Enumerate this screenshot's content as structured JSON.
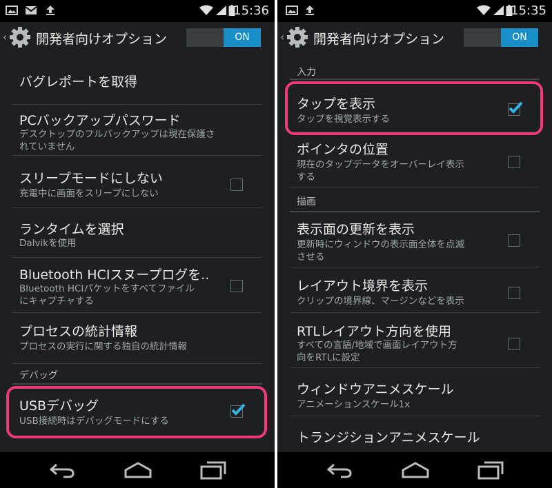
{
  "left": {
    "status": {
      "time": "15:36"
    },
    "header": {
      "title": "開発者向けオプション",
      "switch": "ON"
    },
    "items": [
      {
        "title": "バグレポートを取得"
      },
      {
        "title": "PCバックアップパスワード",
        "sub1": "デスクトップのフルバックアップは現在保護さ",
        "sub2": "れていません"
      },
      {
        "title": "スリープモードにしない",
        "sub1": "充電中に画面をスリープにしない"
      },
      {
        "title": "ランタイムを選択",
        "sub1": "Dalvikを使用"
      },
      {
        "title": "Bluetooth HCIスヌープログを..",
        "sub1": "Bluetooth HCIパケットをすべてファイル",
        "sub2": "にキャプチャする"
      },
      {
        "title": "プロセスの統計情報",
        "sub1": "プロセスの実行に関する独自の統計情報"
      }
    ],
    "category": "デバッグ",
    "usb": {
      "title": "USBデバッグ",
      "sub1": "USB接続時はデバッグモードにする"
    }
  },
  "right": {
    "status": {
      "time": "15:35"
    },
    "header": {
      "title": "開発者向けオプション",
      "switch": "ON"
    },
    "cat_input": "入力",
    "cat_draw": "描画",
    "items": [
      {
        "title": "タップを表示",
        "sub1": "タップを視覚表示する"
      },
      {
        "title": "ポインタの位置",
        "sub1": "現在のタップデータをオーバーレイ表示",
        "sub2": "する"
      },
      {
        "title": "表示面の更新を表示",
        "sub1": "更新時にウィンドウの表示面全体を点滅",
        "sub2": "させる"
      },
      {
        "title": "レイアウト境界を表示",
        "sub1": "クリップの境界線、マージンなどを表示"
      },
      {
        "title": "RTLレイアウト方向を使用",
        "sub1": "すべての言語/地域で画面レイアウト方",
        "sub2": "向をRTLに設定"
      },
      {
        "title": "ウィンドウアニメスケール",
        "sub1": "アニメーションスケール1x"
      },
      {
        "title": "トランジションアニメスケール"
      }
    ]
  },
  "colors": {
    "accent": "#1a8fc7",
    "highlight": "#ee3a78",
    "check": "#33b5e5",
    "bg": "#1d1f22"
  },
  "icons": [
    "picture-icon",
    "mail-icon",
    "upload-icon",
    "wifi-icon",
    "signal-icon",
    "battery-icon",
    "gear-icon",
    "back-icon",
    "home-icon",
    "recents-icon",
    "checkmark-icon"
  ]
}
